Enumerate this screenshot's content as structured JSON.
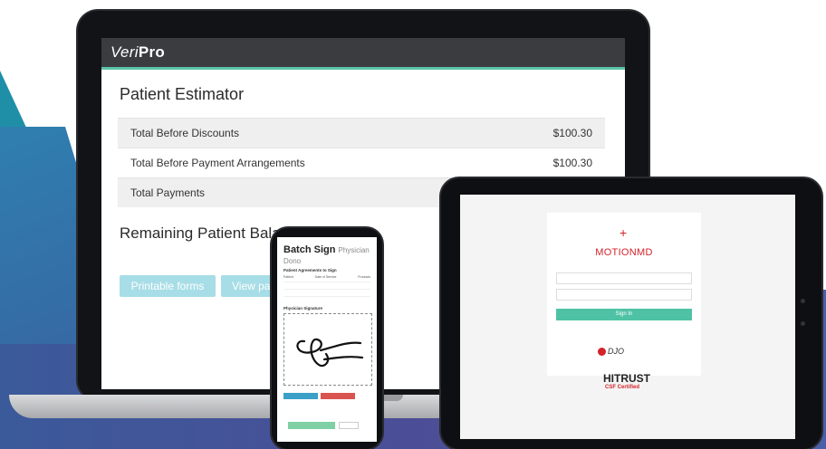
{
  "laptop": {
    "app_logo_light": "Veri",
    "app_logo_bold": "Pro",
    "page_title": "Patient Estimator",
    "rows": [
      {
        "label": "Total Before Discounts",
        "value": "$100.30"
      },
      {
        "label": "Total Before Payment Arrangements",
        "value": "$100.30"
      },
      {
        "label": "Total Payments",
        "value": ""
      }
    ],
    "remaining_label": "Remaining Patient Bala",
    "buttons": {
      "printable_forms": "Printable forms",
      "view_pay": "View pay"
    }
  },
  "phone": {
    "title": "Batch Sign",
    "title_suffix": "Physician Dono",
    "section_agreements": "Patient Agreements to Sign",
    "columns": [
      "Patient",
      "Date of Service",
      "Products"
    ],
    "section_signature": "Physician Signature"
  },
  "tablet": {
    "brand": "MOTIONMD",
    "sign_in": "Sign In",
    "partner_brand": "DJO",
    "certification_main": "HITRUST",
    "certification_sub": "CSF Certified"
  },
  "colors": {
    "teal_accent": "#5bc4a8",
    "header_dark": "#3a3c40",
    "button_light_blue": "#a7dde6",
    "motionmd_red": "#d2232a",
    "signin_green": "#4fc2a5"
  }
}
